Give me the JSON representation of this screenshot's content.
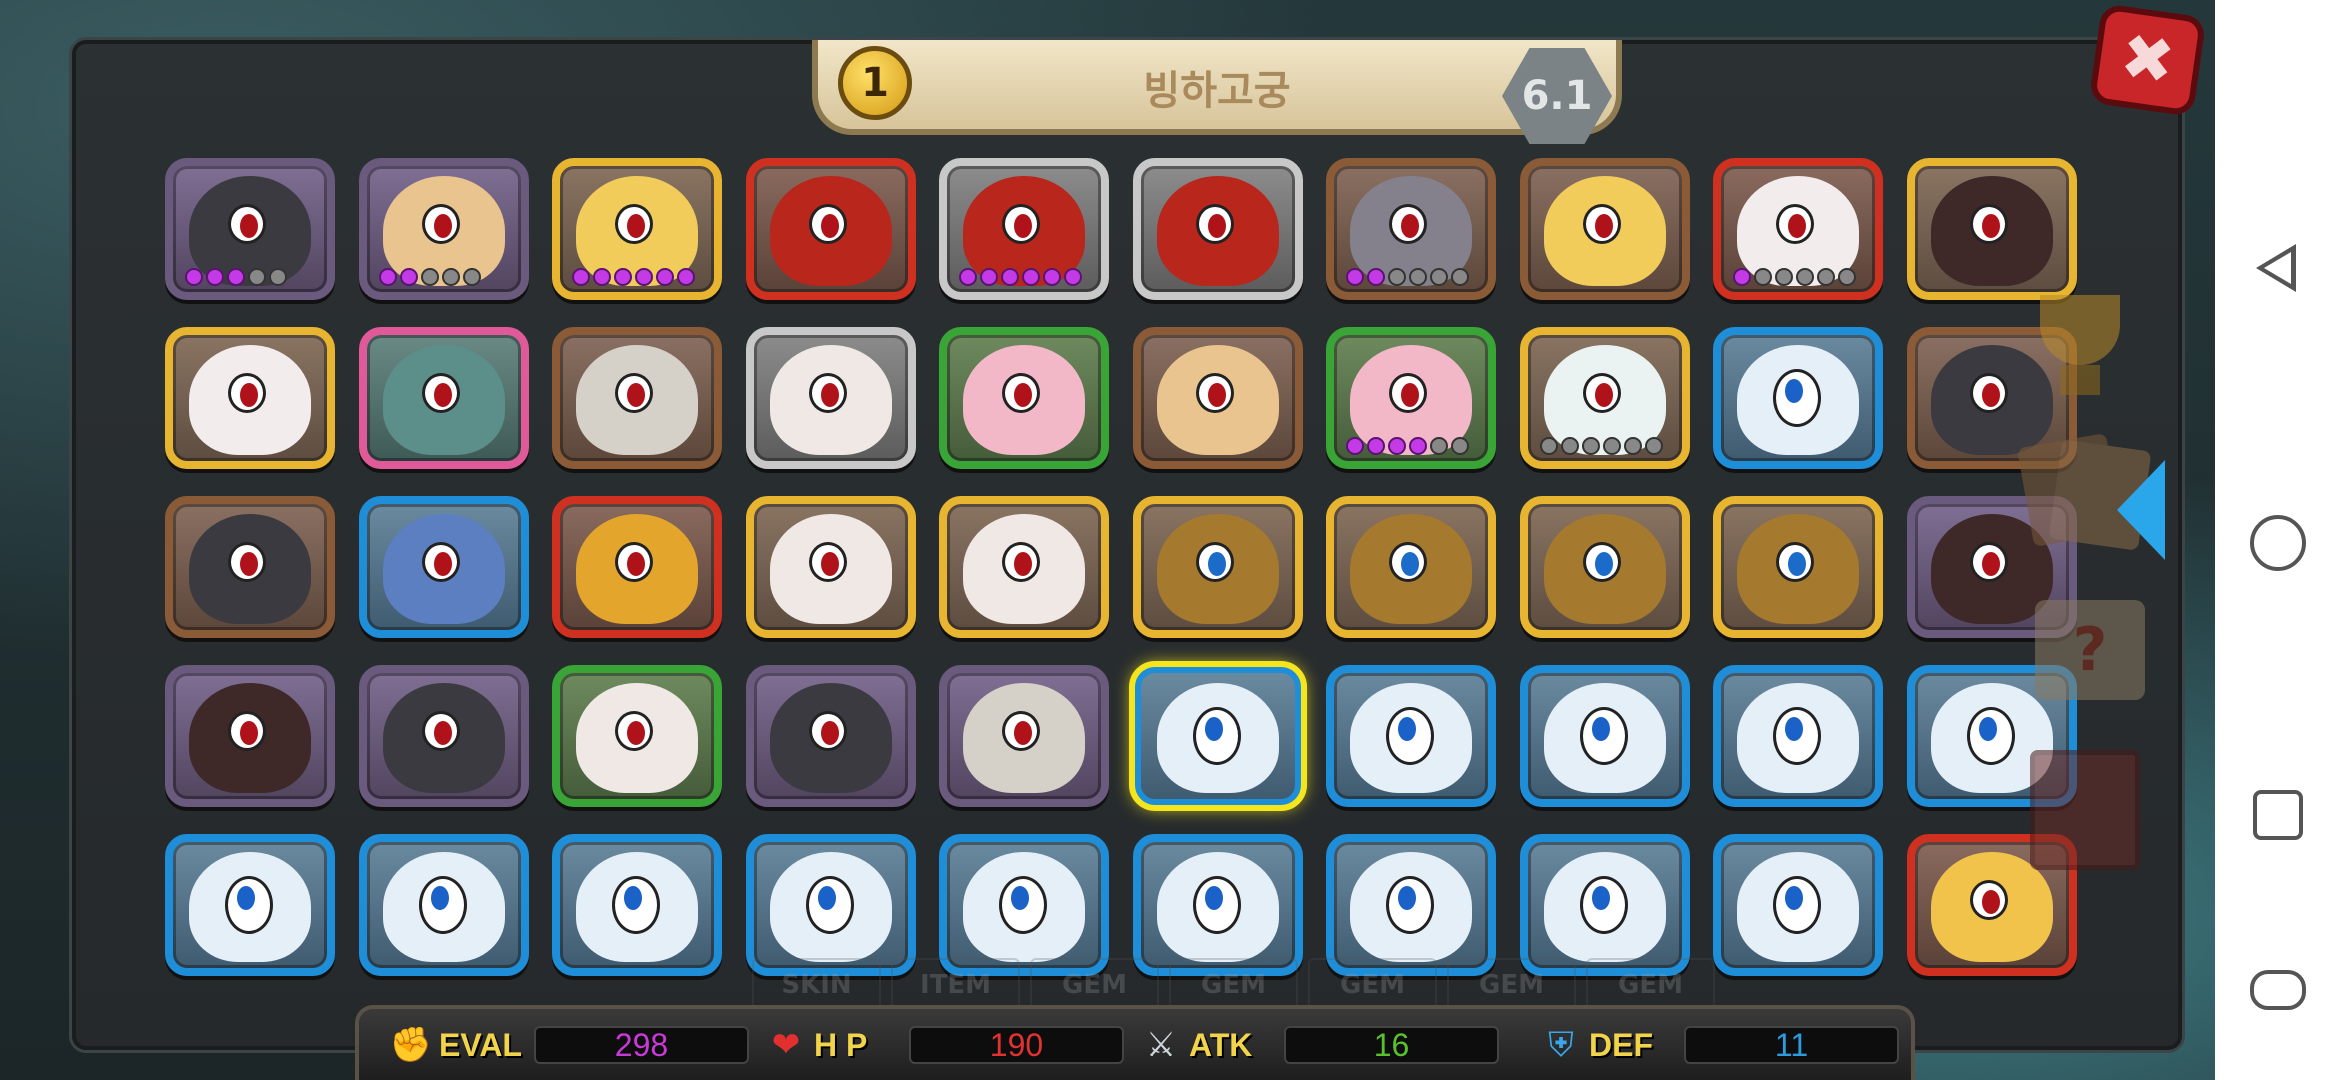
{
  "header": {
    "level": "1",
    "area_name": "빙하고궁",
    "version": "6.1",
    "close_label": "✖"
  },
  "dragon_grid": [
    {
      "kind": "black",
      "rarity": "purple",
      "stars": 5,
      "filled": 3,
      "selected": false
    },
    {
      "kind": "peach",
      "rarity": "purple",
      "stars": 5,
      "filled": 2,
      "selected": false
    },
    {
      "kind": "yellow",
      "rarity": "gold",
      "stars": 6,
      "filled": 6,
      "selected": false
    },
    {
      "kind": "redmech",
      "rarity": "red",
      "stars": 0,
      "filled": 0,
      "selected": false
    },
    {
      "kind": "redmech",
      "rarity": "silver",
      "stars": 6,
      "filled": 6,
      "selected": false
    },
    {
      "kind": "redmech",
      "rarity": "silver",
      "stars": 0,
      "filled": 0,
      "selected": false
    },
    {
      "kind": "grey",
      "rarity": "brown",
      "stars": 6,
      "filled": 2,
      "selected": false
    },
    {
      "kind": "yellow",
      "rarity": "brown",
      "stars": 0,
      "filled": 0,
      "selected": false
    },
    {
      "kind": "whitered",
      "rarity": "red",
      "stars": 6,
      "filled": 1,
      "selected": false
    },
    {
      "kind": "darkred",
      "rarity": "gold",
      "stars": 0,
      "filled": 0,
      "selected": false
    },
    {
      "kind": "whitered",
      "rarity": "gold",
      "stars": 0,
      "filled": 0,
      "selected": false
    },
    {
      "kind": "teal",
      "rarity": "rainbow",
      "stars": 0,
      "filled": 0,
      "selected": false
    },
    {
      "kind": "bandage",
      "rarity": "brown",
      "stars": 0,
      "filled": 0,
      "selected": false
    },
    {
      "kind": "white",
      "rarity": "silver",
      "stars": 0,
      "filled": 0,
      "selected": false
    },
    {
      "kind": "pink",
      "rarity": "green",
      "stars": 0,
      "filled": 0,
      "selected": false
    },
    {
      "kind": "peach",
      "rarity": "brown",
      "stars": 0,
      "filled": 0,
      "selected": false
    },
    {
      "kind": "pink",
      "rarity": "green",
      "stars": 6,
      "filled": 4,
      "selected": false
    },
    {
      "kind": "cyanwhite",
      "rarity": "gold",
      "stars": 6,
      "filled": 0,
      "selected": false
    },
    {
      "kind": "ice",
      "rarity": "blue",
      "stars": 0,
      "filled": 0,
      "selected": false
    },
    {
      "kind": "black",
      "rarity": "brown",
      "stars": 0,
      "filled": 0,
      "selected": false
    },
    {
      "kind": "black",
      "rarity": "brown",
      "stars": 0,
      "filled": 0,
      "selected": false
    },
    {
      "kind": "bluegold",
      "rarity": "blue",
      "stars": 0,
      "filled": 0,
      "selected": false
    },
    {
      "kind": "gold",
      "rarity": "red",
      "stars": 0,
      "filled": 0,
      "selected": false
    },
    {
      "kind": "white",
      "rarity": "gold",
      "stars": 0,
      "filled": 0,
      "selected": false
    },
    {
      "kind": "white",
      "rarity": "gold",
      "stars": 0,
      "filled": 0,
      "selected": false
    },
    {
      "kind": "lion",
      "rarity": "gold",
      "stars": 0,
      "filled": 0,
      "selected": false
    },
    {
      "kind": "lion",
      "rarity": "gold",
      "stars": 0,
      "filled": 0,
      "selected": false
    },
    {
      "kind": "lion",
      "rarity": "gold",
      "stars": 0,
      "filled": 0,
      "selected": false
    },
    {
      "kind": "lion",
      "rarity": "gold",
      "stars": 0,
      "filled": 0,
      "selected": false
    },
    {
      "kind": "darkred",
      "rarity": "purple",
      "stars": 0,
      "filled": 0,
      "selected": false
    },
    {
      "kind": "darkred",
      "rarity": "purple",
      "stars": 0,
      "filled": 0,
      "selected": false
    },
    {
      "kind": "black",
      "rarity": "purple",
      "stars": 0,
      "filled": 0,
      "selected": false
    },
    {
      "kind": "white",
      "rarity": "green",
      "stars": 0,
      "filled": 0,
      "selected": false
    },
    {
      "kind": "black",
      "rarity": "purple",
      "stars": 0,
      "filled": 0,
      "selected": false
    },
    {
      "kind": "bandage",
      "rarity": "purple",
      "stars": 0,
      "filled": 0,
      "selected": false
    },
    {
      "kind": "ice",
      "rarity": "blue",
      "stars": 0,
      "filled": 0,
      "selected": true
    },
    {
      "kind": "ice",
      "rarity": "blue",
      "stars": 0,
      "filled": 0,
      "selected": false
    },
    {
      "kind": "ice",
      "rarity": "blue",
      "stars": 0,
      "filled": 0,
      "selected": false
    },
    {
      "kind": "ice",
      "rarity": "blue",
      "stars": 0,
      "filled": 0,
      "selected": false
    },
    {
      "kind": "ice",
      "rarity": "blue",
      "stars": 0,
      "filled": 0,
      "selected": false
    },
    {
      "kind": "ice",
      "rarity": "blue",
      "stars": 0,
      "filled": 0,
      "selected": false
    },
    {
      "kind": "ice",
      "rarity": "blue",
      "stars": 0,
      "filled": 0,
      "selected": false
    },
    {
      "kind": "ice",
      "rarity": "blue",
      "stars": 0,
      "filled": 0,
      "selected": false
    },
    {
      "kind": "ice",
      "rarity": "blue",
      "stars": 0,
      "filled": 0,
      "selected": false
    },
    {
      "kind": "ice",
      "rarity": "blue",
      "stars": 0,
      "filled": 0,
      "selected": false
    },
    {
      "kind": "ice",
      "rarity": "blue",
      "stars": 0,
      "filled": 0,
      "selected": false
    },
    {
      "kind": "ice",
      "rarity": "blue",
      "stars": 0,
      "filled": 0,
      "selected": false
    },
    {
      "kind": "ice",
      "rarity": "blue",
      "stars": 0,
      "filled": 0,
      "selected": false
    },
    {
      "kind": "ice",
      "rarity": "blue",
      "stars": 0,
      "filled": 0,
      "selected": false
    },
    {
      "kind": "dragongold",
      "rarity": "red",
      "stars": 0,
      "filled": 0,
      "selected": false
    }
  ],
  "side_menu": {
    "icons": [
      "trophy-icon",
      "cards-icon",
      "quest-scroll-icon",
      "book-icon",
      "expand-arrow-icon"
    ]
  },
  "background_tabs": [
    "SKIN",
    "ITEM",
    "GEM",
    "GEM",
    "GEM",
    "GEM",
    "GEM"
  ],
  "stats": {
    "eval": {
      "label": "EVAL",
      "value": "298"
    },
    "hp": {
      "label": "H P",
      "value": "190"
    },
    "atk": {
      "label": "ATK",
      "value": "16"
    },
    "def": {
      "label": "DEF",
      "value": "11"
    }
  },
  "colors": {
    "eval_value": "#c73ad8",
    "hp_value": "#e13232",
    "atk_value": "#59c12c",
    "def_value": "#2c9be0",
    "selected_highlight": "#f5e51c"
  },
  "system_nav": {
    "icons": [
      "back-icon",
      "home-icon",
      "recents-icon",
      "game-mode-icon"
    ]
  }
}
